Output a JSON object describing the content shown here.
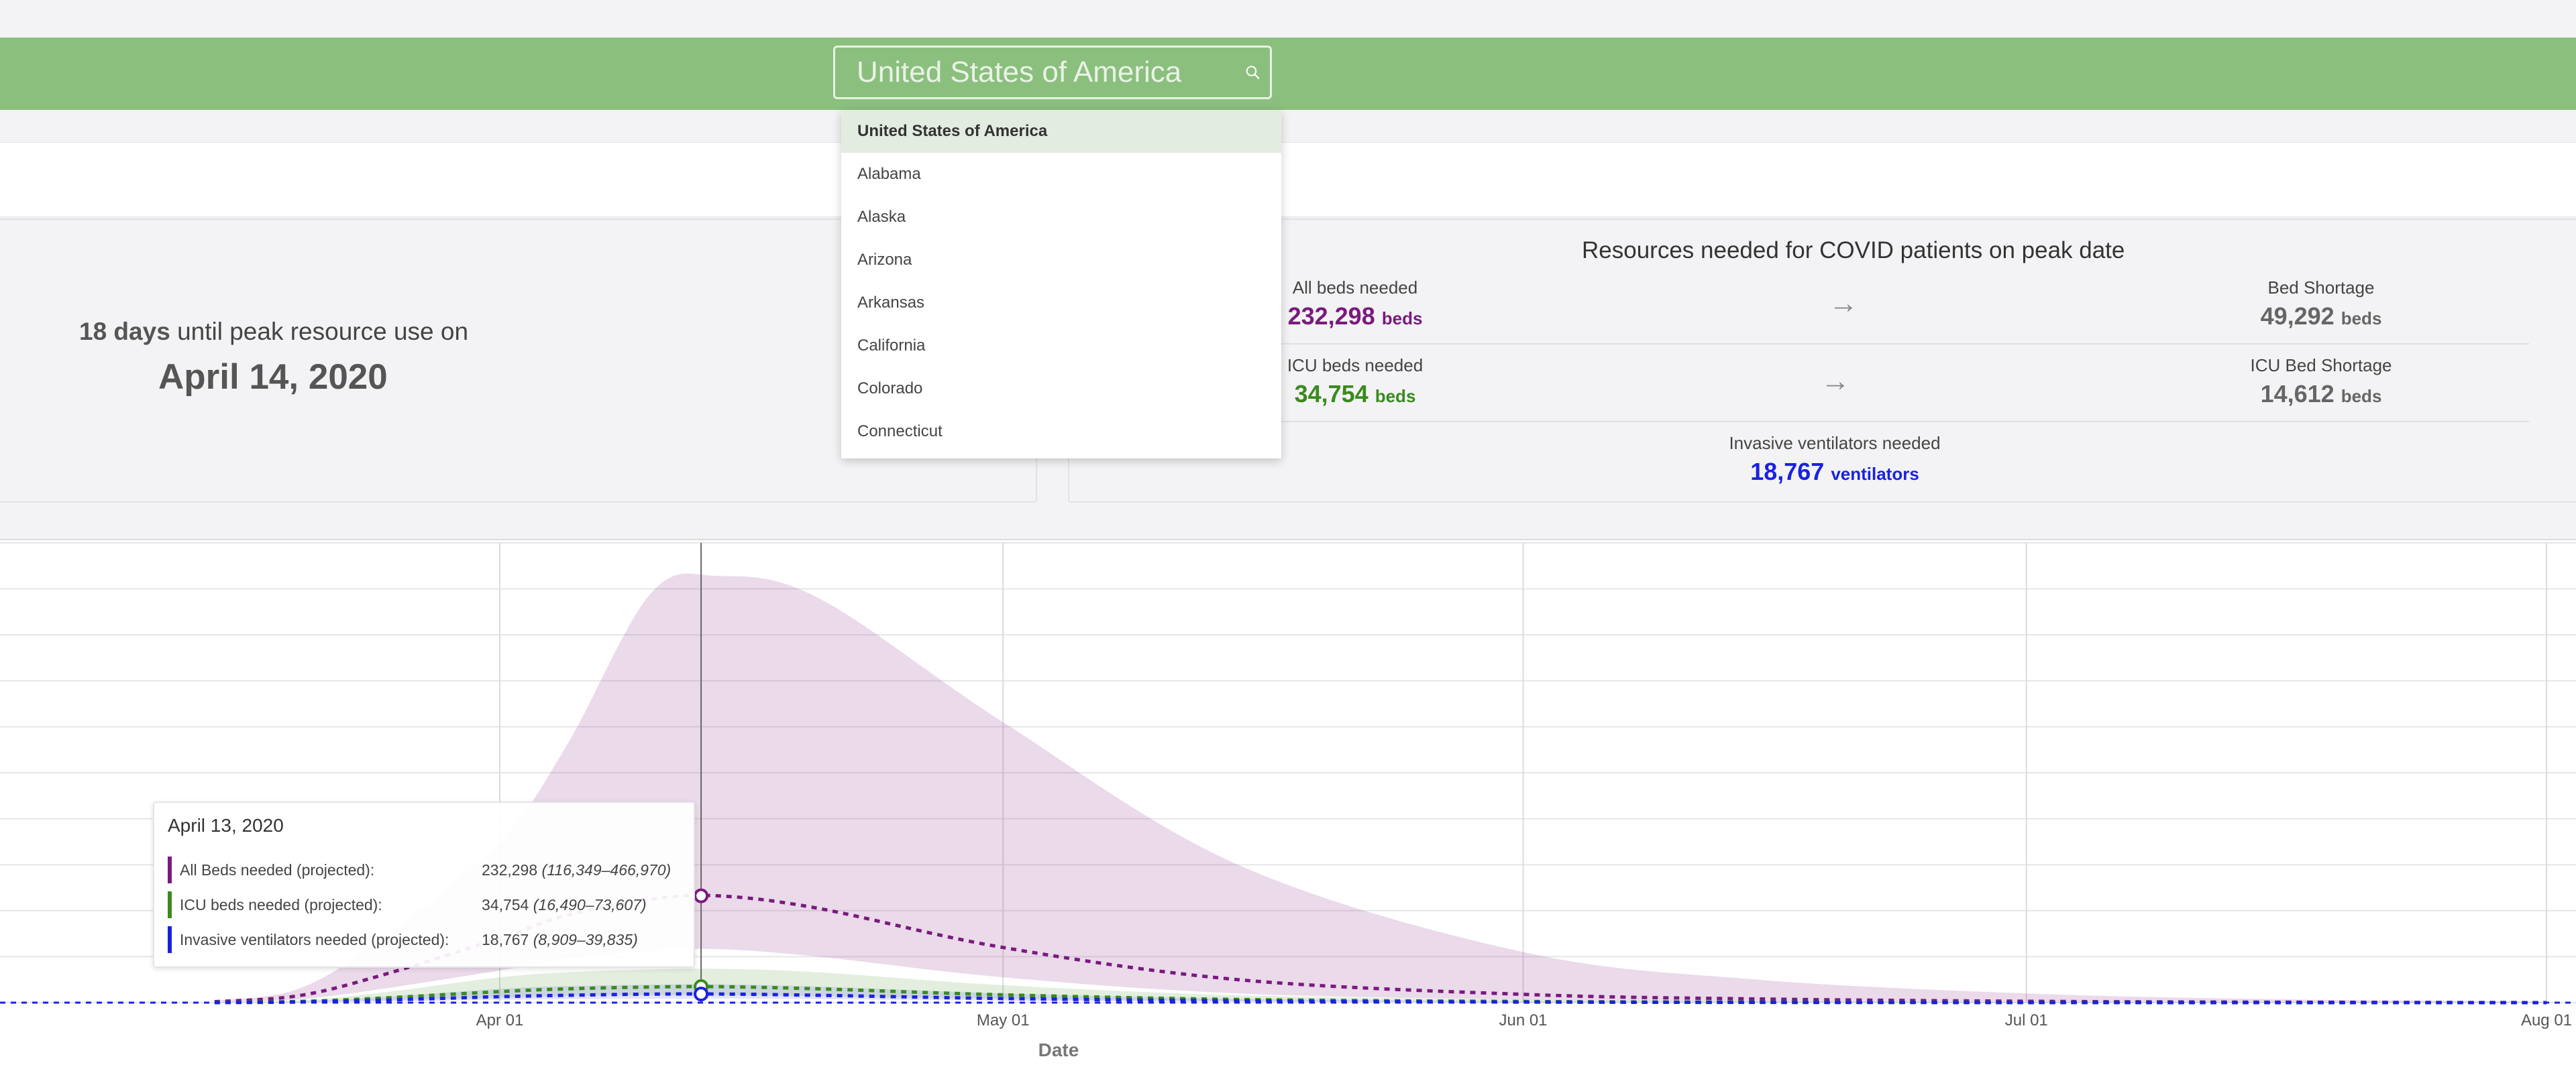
{
  "search": {
    "placeholder": "United States of America"
  },
  "dropdown": {
    "items": [
      {
        "label": "United States of America",
        "selected": true
      },
      {
        "label": "Alabama",
        "selected": false
      },
      {
        "label": "Alaska",
        "selected": false
      },
      {
        "label": "Arizona",
        "selected": false
      },
      {
        "label": "Arkansas",
        "selected": false
      },
      {
        "label": "California",
        "selected": false
      },
      {
        "label": "Colorado",
        "selected": false
      },
      {
        "label": "Connecticut",
        "selected": false
      }
    ]
  },
  "peak": {
    "days": "18 days",
    "text": "until peak resource use on",
    "date": "April 14, 2020"
  },
  "resources": {
    "title": "Resources needed for COVID patients on peak date",
    "all_beds_label": "All beds needed",
    "all_beds_value": "232,298",
    "all_beds_unit": "beds",
    "icu_label": "ICU beds needed",
    "icu_value": "34,754",
    "icu_unit": "beds",
    "bed_shortage_label": "Bed Shortage",
    "bed_shortage_value": "49,292",
    "bed_shortage_unit": "beds",
    "icu_shortage_label": "ICU Bed Shortage",
    "icu_shortage_value": "14,612",
    "icu_shortage_unit": "beds",
    "vent_label": "Invasive ventilators needed",
    "vent_value": "18,767",
    "vent_unit": "ventilators"
  },
  "tooltip": {
    "date": "April 13, 2020",
    "rows": [
      {
        "label": "All Beds needed (projected):",
        "value": "232,298",
        "range": "(116,349–466,970)",
        "color": "#7a1a7e"
      },
      {
        "label": "ICU beds needed (projected):",
        "value": "34,754",
        "range": "(16,490–73,607)",
        "color": "#3a8a1e"
      },
      {
        "label": "Invasive ventilators needed (projected):",
        "value": "18,767",
        "range": "(8,909–39,835)",
        "color": "#1a22e0"
      }
    ]
  },
  "colors": {
    "all_beds": "#7a1a7e",
    "icu": "#3a8a1e",
    "vent": "#1a22e0",
    "header_green": "#8bbf7e"
  },
  "chart_data": {
    "type": "line",
    "xlabel": "Date",
    "ylabel": "",
    "x_ticks": [
      "Apr 01",
      "May 01",
      "Jun 01",
      "Jul 01",
      "Aug 01"
    ],
    "x": [
      "Mar 15",
      "Mar 20",
      "Mar 25",
      "Apr 01",
      "Apr 05",
      "Apr 10",
      "Apr 14",
      "Apr 20",
      "May 01",
      "May 15",
      "Jun 01",
      "Jun 15",
      "Jul 01",
      "Jul 15",
      "Aug 01"
    ],
    "ylim": [
      0,
      1000000
    ],
    "grid": true,
    "series": [
      {
        "name": "All Beds needed (projected)",
        "color": "#7a1a7e",
        "values": [
          2000,
          15000,
          60000,
          140000,
          190000,
          225000,
          232298,
          205000,
          120000,
          50000,
          18000,
          8000,
          3000,
          1000,
          0
        ],
        "upper": [
          4000,
          30000,
          140000,
          350000,
          560000,
          890000,
          928000,
          880000,
          610000,
          300000,
          110000,
          50000,
          20000,
          8000,
          2000
        ],
        "lower": [
          800,
          7000,
          30000,
          70000,
          95000,
          112000,
          116349,
          100000,
          55000,
          20000,
          6000,
          2000,
          500,
          0,
          0
        ]
      },
      {
        "name": "ICU beds needed (projected)",
        "color": "#3a8a1e",
        "values": [
          300,
          2500,
          10000,
          24000,
          30000,
          34000,
          34754,
          30000,
          17000,
          7000,
          2500,
          1000,
          400,
          100,
          0
        ],
        "upper": [
          600,
          5000,
          22000,
          55000,
          66000,
          72000,
          73607,
          66000,
          38000,
          16000,
          6000,
          2500,
          900,
          300,
          0
        ],
        "lower": [
          150,
          1200,
          5000,
          11000,
          14000,
          16000,
          16490,
          14000,
          8000,
          3000,
          1000,
          400,
          150,
          0,
          0
        ]
      },
      {
        "name": "Invasive ventilators needed (projected)",
        "color": "#1a22e0",
        "values": [
          150,
          1300,
          5500,
          13000,
          16000,
          18500,
          18767,
          16000,
          9000,
          3800,
          1300,
          500,
          200,
          50,
          0
        ],
        "upper": [
          300,
          2800,
          12000,
          30000,
          36000,
          39000,
          39835,
          35000,
          20000,
          8500,
          3000,
          1200,
          450,
          150,
          0
        ],
        "lower": [
          70,
          600,
          2600,
          6000,
          7500,
          8500,
          8909,
          7500,
          4200,
          1700,
          600,
          200,
          80,
          0,
          0
        ]
      }
    ]
  }
}
